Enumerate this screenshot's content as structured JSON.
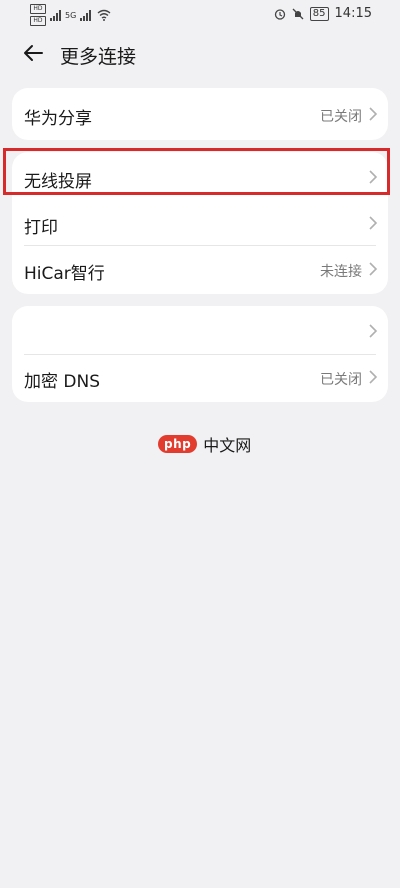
{
  "status_bar": {
    "sim1": "HD",
    "sim2": "HD",
    "network": "5G",
    "battery": "85",
    "time": "14:15",
    "icons": [
      "alarm-icon",
      "mute-icon",
      "battery-icon",
      "wifi-icon",
      "signal-icon"
    ]
  },
  "header": {
    "title": "更多连接",
    "back_icon": "back-arrow-icon"
  },
  "groups": [
    {
      "items": [
        {
          "label": "华为分享",
          "value": "已关闭"
        }
      ]
    },
    {
      "items": [
        {
          "label": "无线投屏",
          "value": ""
        },
        {
          "label": "打印",
          "value": ""
        },
        {
          "label": "HiCar智行",
          "value": "未连接"
        }
      ]
    },
    {
      "items": [
        {
          "label": "",
          "value": ""
        },
        {
          "label": "加密 DNS",
          "value": "已关闭"
        }
      ]
    }
  ],
  "highlight_color": "#d72b2b",
  "watermark": {
    "badge": "php",
    "text": "中文网"
  }
}
